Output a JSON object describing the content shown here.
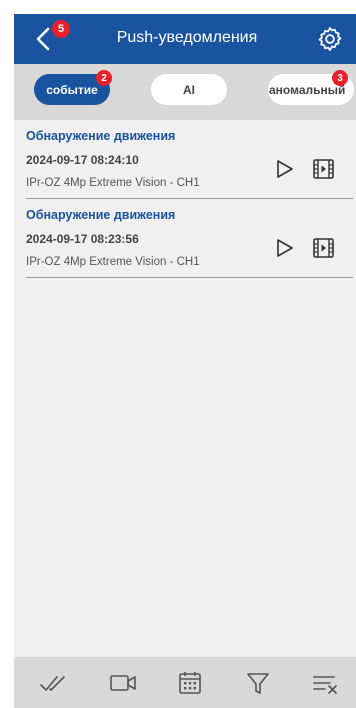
{
  "header": {
    "title": "Push-уведомления",
    "back_badge": "5",
    "back_icon": "chevron-left-icon",
    "settings_icon": "gear-icon"
  },
  "filters": {
    "tabs": [
      {
        "label": "событие",
        "badge": "2",
        "active": true
      },
      {
        "label": "AI",
        "badge": "",
        "active": false
      },
      {
        "label": "аномальный",
        "badge": "3",
        "active": false
      }
    ]
  },
  "events": [
    {
      "title": "Обнаружение движения",
      "datetime": "2024-09-17 08:24:10",
      "device": "IPr-OZ 4Mp Extreme Vision - CH1"
    },
    {
      "title": "Обнаружение движения",
      "datetime": "2024-09-17 08:23:56",
      "device": "IPr-OZ 4Mp Extreme Vision - CH1"
    }
  ],
  "bottom_bar": {
    "icons": [
      "double-check-icon",
      "video-camera-icon",
      "calendar-icon",
      "filter-icon",
      "clear-list-icon"
    ]
  },
  "colors": {
    "primary": "#1a54a0",
    "badge": "#e8202c",
    "toolbar_bg": "#d8d8d8",
    "content_bg": "#f0f0f0"
  }
}
